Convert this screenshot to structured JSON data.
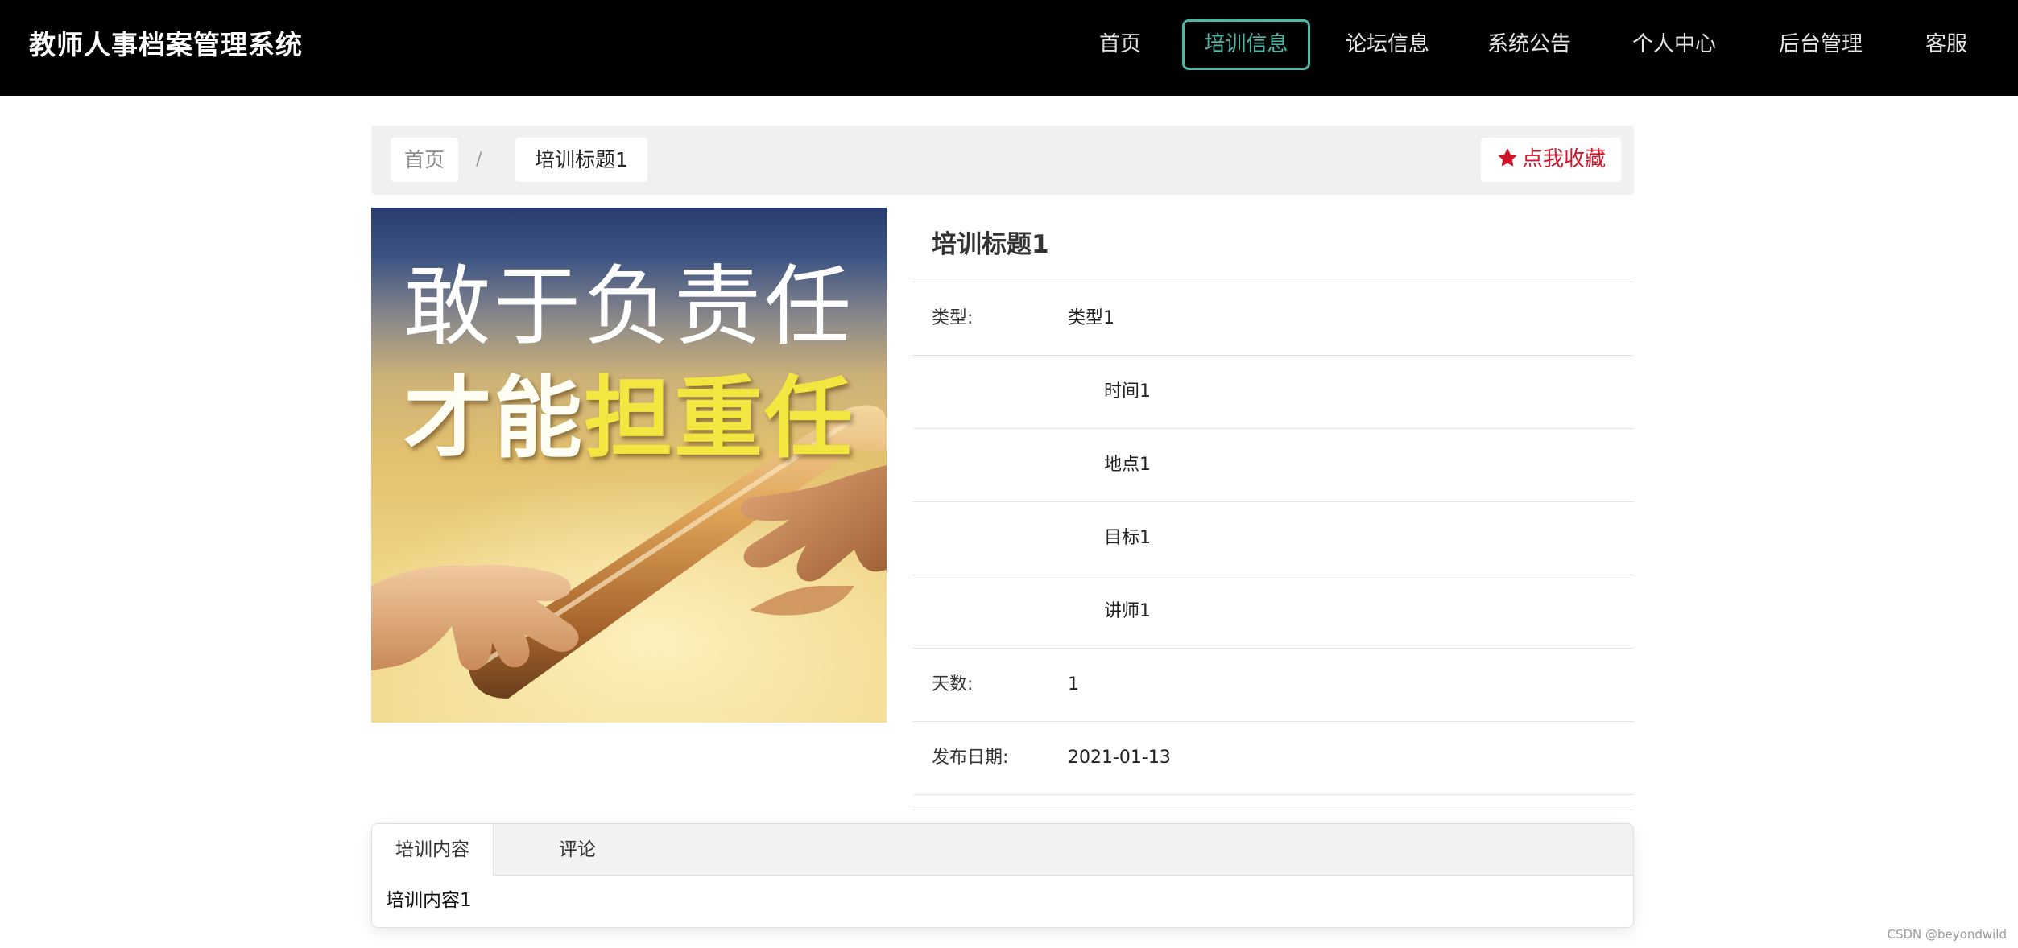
{
  "header": {
    "brand": "教师人事档案管理系统",
    "nav": [
      "首页",
      "培训信息",
      "论坛信息",
      "系统公告",
      "个人中心",
      "后台管理",
      "客服"
    ],
    "active_index": 1,
    "accent_color": "#4db6a4"
  },
  "breadcrumb": {
    "home": "首页",
    "separator": "/",
    "current": "培训标题1"
  },
  "favorite_button": {
    "label": "点我收藏",
    "icon": "star-icon",
    "color": "#d2142a"
  },
  "poster": {
    "line1": "敢于负责任",
    "line2_white": "才能",
    "line2_yellow": "担重任"
  },
  "detail": {
    "title": "培训标题1",
    "type_label": "类型:",
    "type_value": "类型1",
    "time_value": "时间1",
    "place_value": "地点1",
    "goal_value": "目标1",
    "teacher_value": "讲师1",
    "days_label": "天数:",
    "days_value": "1",
    "date_label": "发布日期:",
    "date_value": "2021-01-13"
  },
  "tabs": {
    "content_label": "培训内容",
    "comment_label": "评论",
    "content_text": "培训内容1"
  },
  "watermark": "CSDN @beyondwild"
}
